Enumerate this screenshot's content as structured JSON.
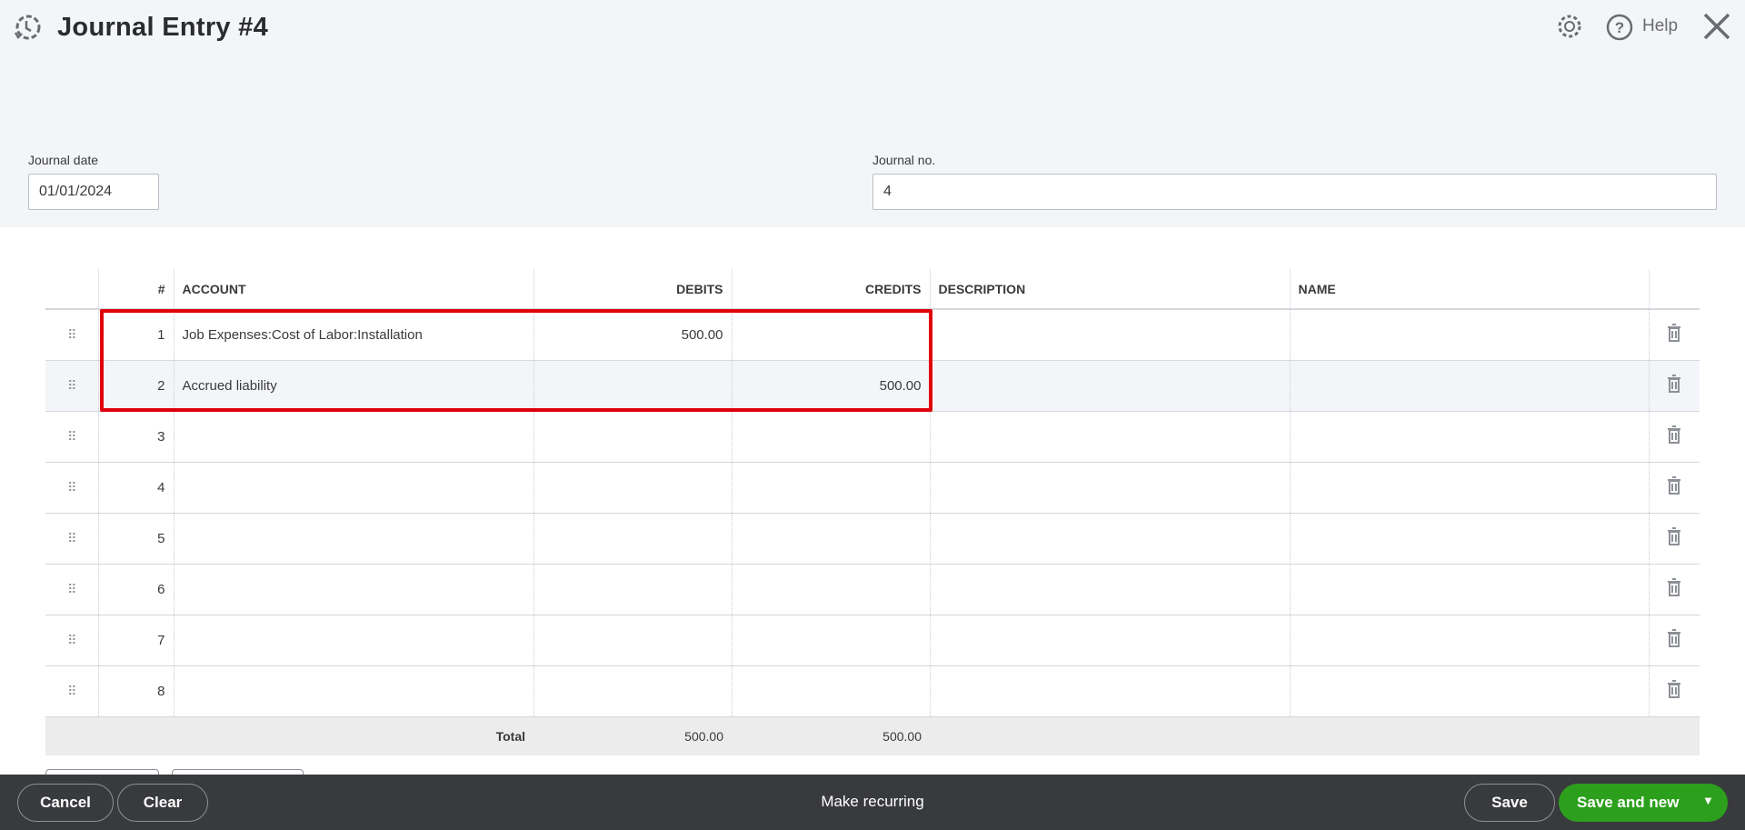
{
  "header": {
    "title": "Journal Entry #4",
    "help_label": "Help"
  },
  "form": {
    "journal_date_label": "Journal date",
    "journal_date_value": "01/01/2024",
    "journal_no_label": "Journal no.",
    "journal_no_value": "4"
  },
  "table": {
    "columns": [
      "#",
      "ACCOUNT",
      "DEBITS",
      "CREDITS",
      "DESCRIPTION",
      "NAME"
    ],
    "rows": [
      {
        "n": "1",
        "account": "Job Expenses:Cost of Labor:Installation",
        "debit": "500.00",
        "credit": "",
        "description": "",
        "name": ""
      },
      {
        "n": "2",
        "account": "Accrued liability",
        "debit": "",
        "credit": "500.00",
        "description": "",
        "name": ""
      },
      {
        "n": "3",
        "account": "",
        "debit": "",
        "credit": "",
        "description": "",
        "name": ""
      },
      {
        "n": "4",
        "account": "",
        "debit": "",
        "credit": "",
        "description": "",
        "name": ""
      },
      {
        "n": "5",
        "account": "",
        "debit": "",
        "credit": "",
        "description": "",
        "name": ""
      },
      {
        "n": "6",
        "account": "",
        "debit": "",
        "credit": "",
        "description": "",
        "name": ""
      },
      {
        "n": "7",
        "account": "",
        "debit": "",
        "credit": "",
        "description": "",
        "name": ""
      },
      {
        "n": "8",
        "account": "",
        "debit": "",
        "credit": "",
        "description": "",
        "name": ""
      }
    ],
    "total_label": "Total",
    "total_debits": "500.00",
    "total_credits": "500.00"
  },
  "footer": {
    "cancel": "Cancel",
    "clear": "Clear",
    "make_recurring": "Make recurring",
    "save": "Save",
    "save_and_new": "Save and new"
  },
  "colors": {
    "accent_green": "#2ca01c",
    "highlight_red": "#e0000b",
    "footer_bg": "#393a3d"
  }
}
